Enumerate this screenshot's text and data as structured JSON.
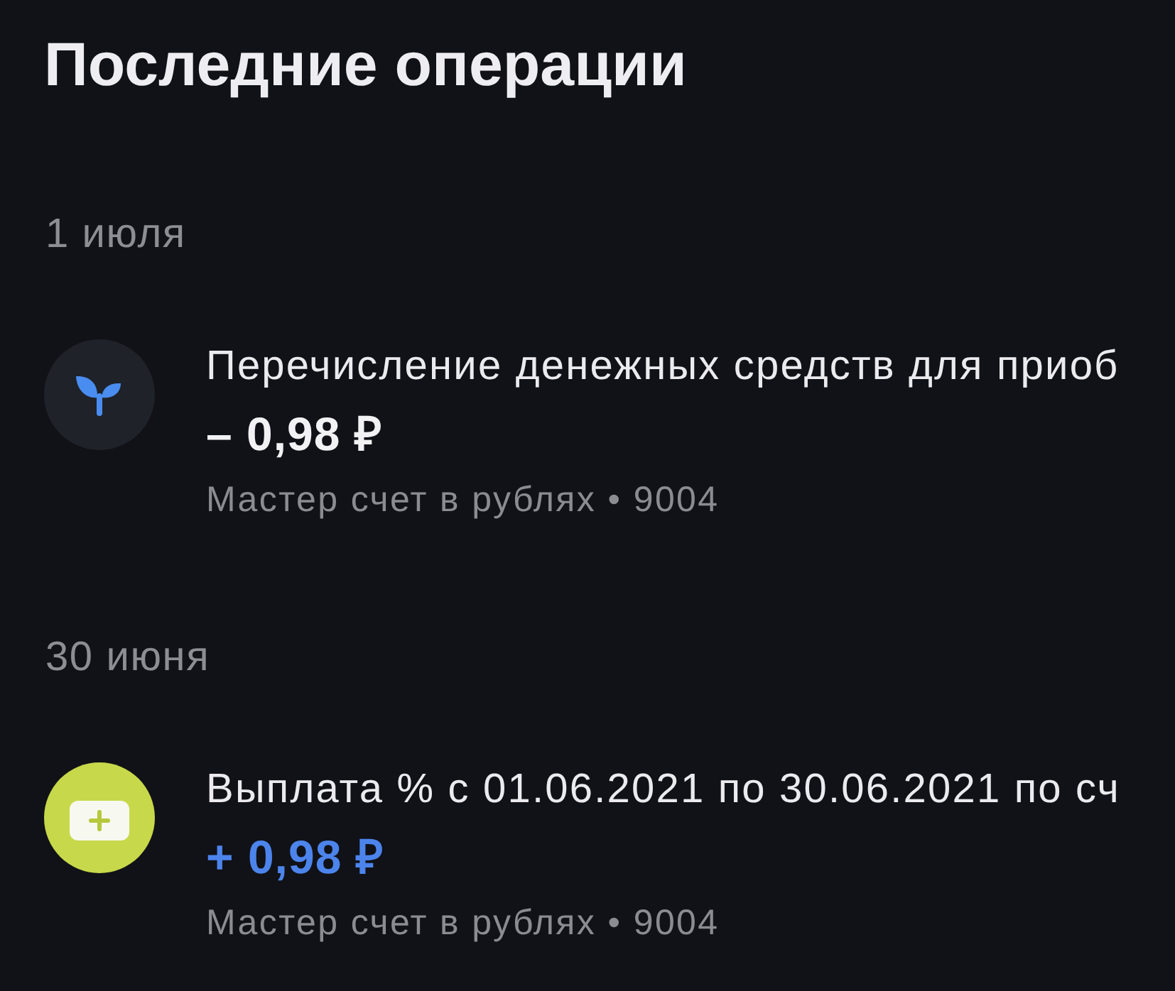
{
  "title": "Последние операции",
  "groups": [
    {
      "date": "1 июля",
      "operations": [
        {
          "kind": "sprout",
          "incoming": false,
          "title": "Перечисление денежных средств для приоб",
          "amount": "– 0,98 ₽",
          "account": "Мастер счет в рублях • 9004"
        }
      ]
    },
    {
      "date": "30 июня",
      "operations": [
        {
          "kind": "card",
          "incoming": true,
          "title": "Выплата % с 01.06.2021 по 30.06.2021 по сч",
          "amount": "+ 0,98 ₽",
          "account": "Мастер счет в рублях • 9004"
        }
      ]
    }
  ]
}
